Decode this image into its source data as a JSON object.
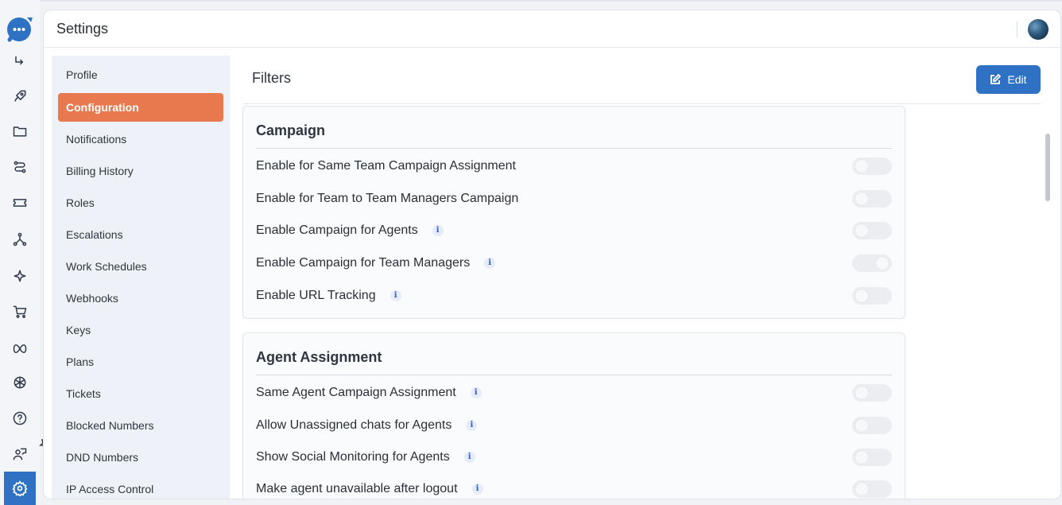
{
  "header": {
    "title": "Settings"
  },
  "menu": {
    "items": [
      {
        "label": "Profile",
        "active": false
      },
      {
        "label": "Configuration",
        "active": true
      },
      {
        "label": "Notifications",
        "active": false
      },
      {
        "label": "Billing History",
        "active": false
      },
      {
        "label": "Roles",
        "active": false
      },
      {
        "label": "Escalations",
        "active": false
      },
      {
        "label": "Work Schedules",
        "active": false
      },
      {
        "label": "Webhooks",
        "active": false
      },
      {
        "label": "Keys",
        "active": false
      },
      {
        "label": "Plans",
        "active": false
      },
      {
        "label": "Tickets",
        "active": false
      },
      {
        "label": "Blocked Numbers",
        "active": false
      },
      {
        "label": "DND Numbers",
        "active": false
      },
      {
        "label": "IP Access Control",
        "active": false
      }
    ]
  },
  "content": {
    "title": "Filters",
    "edit_label": "Edit",
    "sections": [
      {
        "title": "Campaign",
        "rows": [
          {
            "label": "Enable for Same Team Campaign Assignment",
            "info": false,
            "on": false
          },
          {
            "label": "Enable for Team to Team Managers Campaign",
            "info": false,
            "on": false
          },
          {
            "label": "Enable Campaign for Agents",
            "info": true,
            "on": false
          },
          {
            "label": "Enable Campaign for Team Managers",
            "info": true,
            "on": true
          },
          {
            "label": "Enable URL Tracking",
            "info": true,
            "on": false
          }
        ]
      },
      {
        "title": "Agent Assignment",
        "rows": [
          {
            "label": "Same Agent Campaign Assignment",
            "info": true,
            "on": false
          },
          {
            "label": "Allow Unassigned chats for Agents",
            "info": true,
            "on": false
          },
          {
            "label": "Show Social Monitoring for Agents",
            "info": true,
            "on": false
          },
          {
            "label": "Make agent unavailable after logout",
            "info": true,
            "on": false
          }
        ]
      }
    ]
  },
  "info_glyph": "i",
  "colors": {
    "accent": "#2f72c4",
    "active_menu": "#e8784d"
  },
  "rail_icons": [
    "chat-logo-icon",
    "flow-icon",
    "rocket-icon",
    "folder-icon",
    "workflow-icon",
    "ticket-icon",
    "network-icon",
    "sparkle-icon",
    "cart-icon",
    "meta-icon",
    "openai-icon",
    "help-icon",
    "agent-icon",
    "settings-icon"
  ]
}
